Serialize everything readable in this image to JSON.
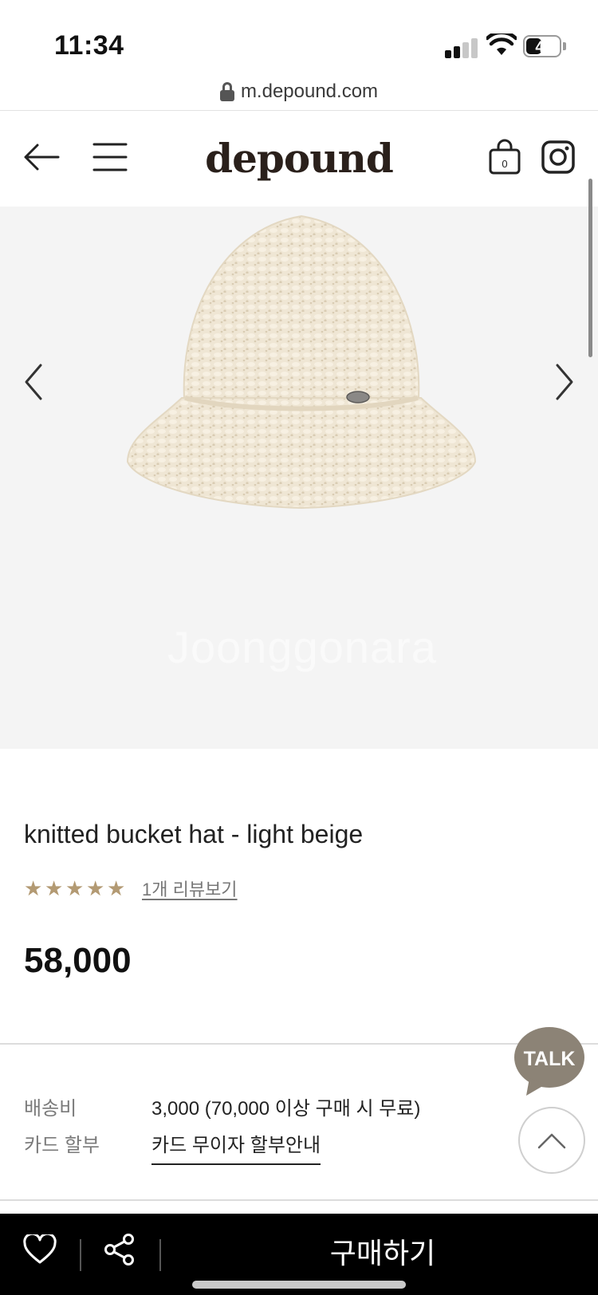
{
  "status_bar": {
    "time": "11:34",
    "battery": "43",
    "battery_level": 0.43
  },
  "url_bar": {
    "url": "m.depound.com"
  },
  "header": {
    "logo": "depound",
    "cart_count": "0"
  },
  "gallery": {
    "watermark": "Joonggonara"
  },
  "product": {
    "name": "knitted bucket hat - light beige",
    "rating": 5,
    "review_link": "1개 리뷰보기",
    "price": "58,000"
  },
  "info": {
    "shipping_label": "배송비",
    "shipping_value": "3,000 (70,000 이상 구매 시 무료)",
    "card_label": "카드 할부",
    "card_value": "카드 무이자 할부안내"
  },
  "floating": {
    "talk_label": "TALK"
  },
  "bottom_bar": {
    "buy_label": "구매하기"
  },
  "colors": {
    "logo": "#2a201b",
    "star": "#b39a73",
    "talk_bubble": "#8c8376",
    "gallery_bg": "#f4f4f4",
    "hat": "#efe6d4"
  }
}
